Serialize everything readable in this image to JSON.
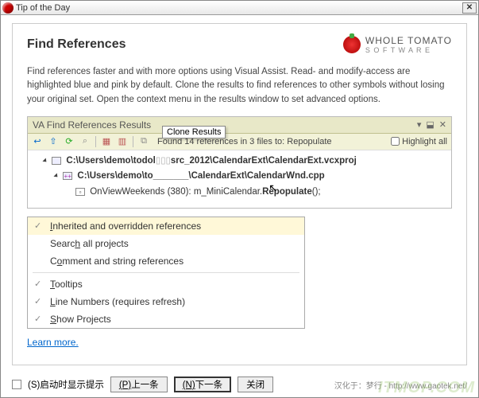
{
  "window": {
    "title": "Tip of the Day"
  },
  "heading": "Find References",
  "logo": {
    "line1": "WHOLE TOMATO",
    "line2": "S O F T W A R E"
  },
  "description": "Find references faster and with more options using Visual Assist. Read- and modify-access are highlighted blue and pink by default. Clone the results to find references to other symbols without losing your original set. Open the context menu in the results window to set advanced options.",
  "panel": {
    "title": "VA Find References Results",
    "status": "Found 14 references in 3 files to: Repopulate",
    "highlight_label": "Highlight all",
    "tooltip": "Clone Results",
    "tree": {
      "row1_a": "C:\\Users\\demo\\todol",
      "row1_b": "src_2012\\CalendarExt\\CalendarExt.vcxproj",
      "row2": "C:\\Users\\demo\\to_______\\CalendarExt\\CalendarWnd.cpp",
      "row3_a": "OnViewWeekends (380):    m_MiniCalendar.",
      "row3_b": "Repopulate",
      "row3_c": "();"
    }
  },
  "contextmenu": {
    "items": [
      {
        "label": "Inherited and overridden references",
        "checked": true,
        "highlight": true
      },
      {
        "label": "Search all projects",
        "checked": false
      },
      {
        "label": "Comment and string references",
        "checked": false
      },
      {
        "sep": true
      },
      {
        "label": "Tooltips",
        "checked": true
      },
      {
        "label": "Line Numbers (requires refresh)",
        "checked": true
      },
      {
        "label": "Show Projects",
        "checked": true
      }
    ]
  },
  "learn_more": "Learn more.",
  "footer": {
    "show_on_startup": "(S)启动时显示提示",
    "prev": "(P)上一条",
    "next": "(N)下一条",
    "close": "关闭",
    "credit": "汉化于：梦行 - http://www.gaotek.net/"
  },
  "watermark": "ITMOP.COM"
}
